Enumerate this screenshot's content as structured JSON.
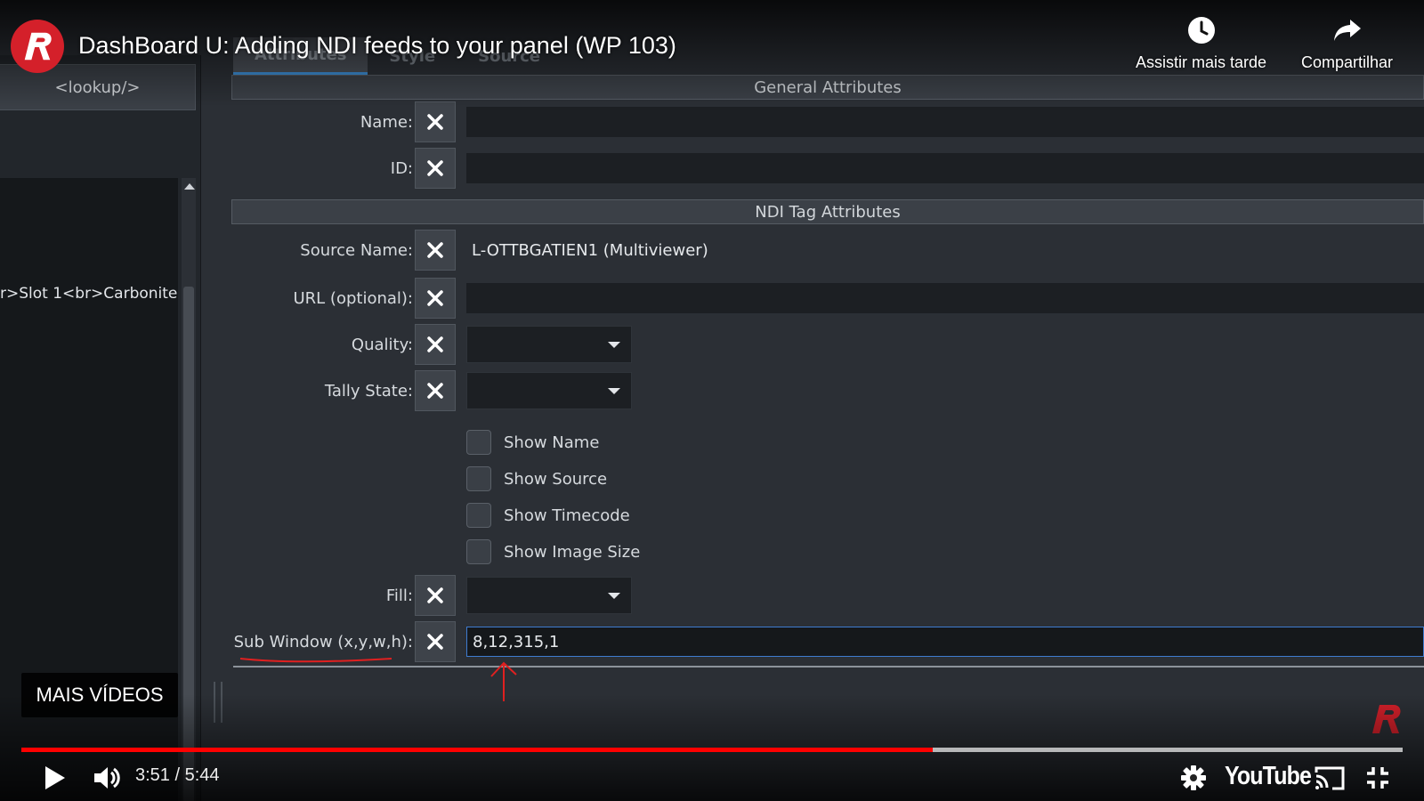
{
  "video": {
    "title": "DashBoard U: Adding NDI feeds to your panel (WP 103)",
    "watch_later_label": "Assistir mais tarde",
    "share_label": "Compartilhar",
    "more_videos_label": "MAIS VÍDEOS",
    "time_display": "3:51 / 5:44",
    "progress_fraction": 0.66,
    "buffered_fraction": 1.0,
    "youtube_wordmark": "YouTube",
    "accent_color": "#ff0000"
  },
  "app": {
    "tabs": [
      {
        "label": "Attributes",
        "active": true
      },
      {
        "label": "Style",
        "active": false
      },
      {
        "label": "Source",
        "active": false
      }
    ],
    "left_pane": {
      "lookup_label": "<lookup/>",
      "tree_item": "r>Slot 1<br>Carbonite]"
    },
    "general_header": "General Attributes",
    "name_label": "Name:",
    "name_value": "",
    "id_label": "ID:",
    "id_value": "",
    "ndi_header": "NDI Tag Attributes",
    "source_name_label": "Source Name:",
    "source_name_value": "L-OTTBGATIEN1 (Multiviewer)",
    "url_label": "URL (optional):",
    "url_value": "",
    "quality_label": "Quality:",
    "quality_value": "",
    "tally_label": "Tally State:",
    "tally_value": "",
    "checkboxes": [
      {
        "label": "Show Name",
        "checked": false
      },
      {
        "label": "Show Source",
        "checked": false
      },
      {
        "label": "Show Timecode",
        "checked": false
      },
      {
        "label": "Show Image Size",
        "checked": false
      }
    ],
    "fill_label": "Fill:",
    "fill_value": "",
    "sub_window_label": "Sub Window (x,y,w,h):",
    "sub_window_value": "8,12,315,1",
    "focus_color": "#3e7bd0"
  }
}
